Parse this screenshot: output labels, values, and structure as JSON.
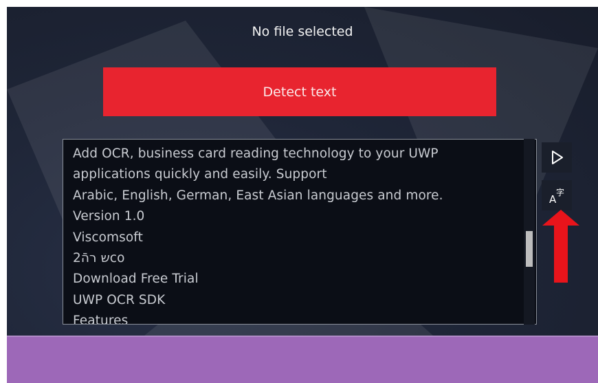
{
  "header": {
    "file_status": "No file selected"
  },
  "actions": {
    "detect_label": "Detect text"
  },
  "output": {
    "lines": [
      "Add OCR, business card reading technology to your UWP",
      "applications quickly and easily. Support",
      "Arabic, English, German, East Asian languages and more.",
      "Version 1.0",
      "Viscomsoft",
      "2ש רהֿco",
      "Download Free Trial",
      "UWP OCR SDK",
      "Features"
    ],
    "scroll_position": 0.62
  },
  "side_buttons": [
    {
      "icon": "play-icon"
    },
    {
      "icon": "translate-icon",
      "glyph_a": "A",
      "glyph_b": "字"
    }
  ],
  "annotation": {
    "icon": "red-arrow-up-icon",
    "color": "#e8141b"
  },
  "colors": {
    "accent": "#e8242f",
    "footer": "#9d68b8",
    "background": "#1f2638"
  }
}
